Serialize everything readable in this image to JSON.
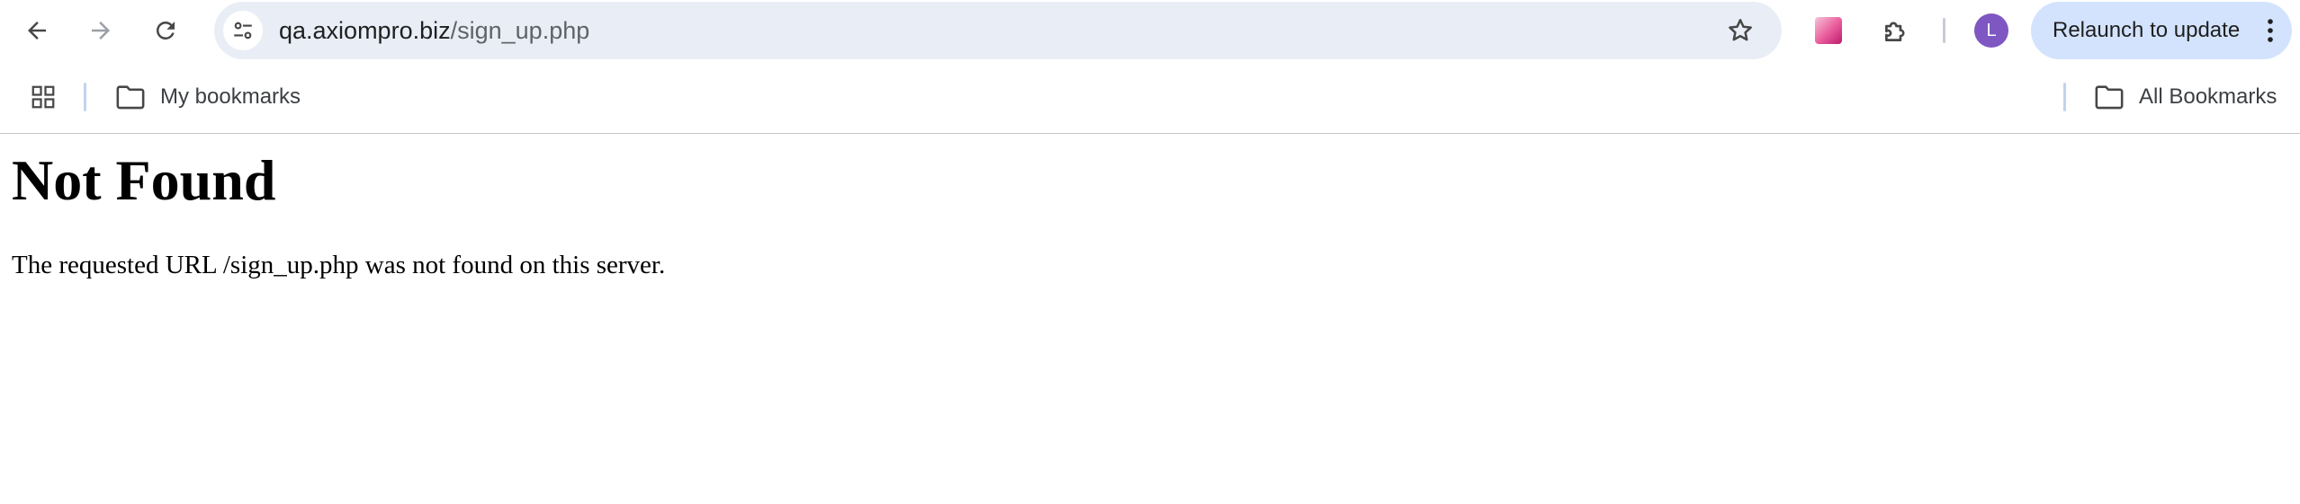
{
  "browser": {
    "toolbar": {
      "back_icon": "arrow-left-icon",
      "forward_icon": "arrow-right-icon",
      "reload_icon": "reload-icon",
      "omnibox": {
        "site_info_icon": "tune-icon",
        "url_host": "qa.axiompro.biz",
        "url_path": "/sign_up.php",
        "star_icon": "star-outline-icon"
      },
      "extensions": {
        "gradient_extension_icon": "gradient-square-icon",
        "puzzle_icon": "puzzle-piece-icon"
      },
      "profile": {
        "initial": "L",
        "color": "#7e57c2"
      },
      "relaunch": {
        "label": "Relaunch to update",
        "menu_icon": "three-dots-vertical-icon",
        "bg_color": "#d3e3fd"
      }
    },
    "bookmarks_bar": {
      "apps_icon": "apps-grid-icon",
      "left_folder": {
        "label": "My bookmarks",
        "icon": "folder-icon"
      },
      "right_folder": {
        "label": "All Bookmarks",
        "icon": "folder-icon"
      }
    }
  },
  "page": {
    "heading": "Not Found",
    "message": "The requested URL /sign_up.php was not found on this server."
  },
  "colors": {
    "omnibox_bg": "#e9eef6",
    "icon_gray": "#474747",
    "disabled_gray": "#9aa0a6"
  }
}
